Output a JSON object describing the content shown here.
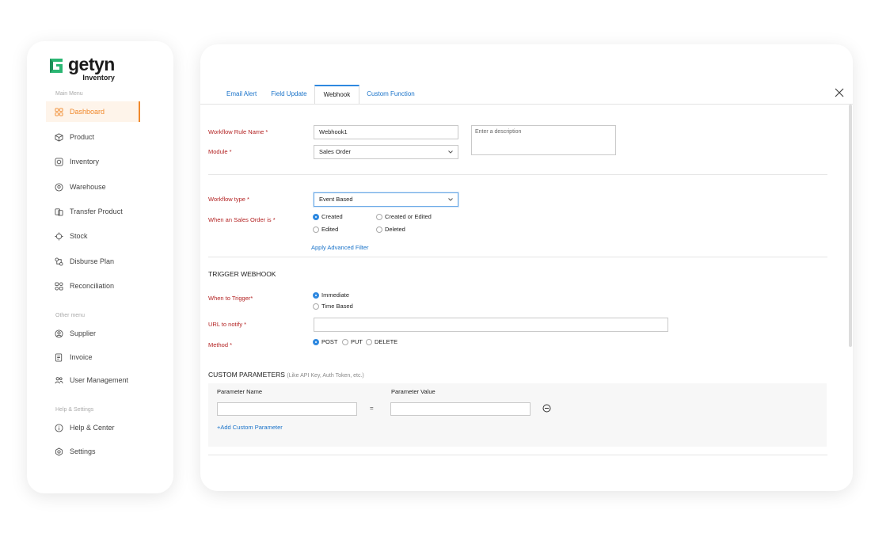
{
  "brand": {
    "name": "getyn",
    "sub": "Inventory",
    "accent": "#f0892c",
    "logo_color": "#2bb673"
  },
  "sidebar": {
    "main_menu_label": "Main Menu",
    "main_items": [
      {
        "label": "Dashboard",
        "icon": "grid-icon",
        "active": true
      },
      {
        "label": "Product",
        "icon": "box-icon"
      },
      {
        "label": "Inventory",
        "icon": "inventory-icon"
      },
      {
        "label": "Warehouse",
        "icon": "location-pin-icon"
      },
      {
        "label": "Transfer Product",
        "icon": "transfer-icon"
      },
      {
        "label": "Stock",
        "icon": "stock-icon"
      },
      {
        "label": "Disburse Plan",
        "icon": "disburse-icon"
      },
      {
        "label": "Reconciliation",
        "icon": "reconciliation-icon"
      }
    ],
    "other_menu_label": "Other menu",
    "other_items": [
      {
        "label": "Supplier",
        "icon": "supplier-icon"
      },
      {
        "label": "Invoice",
        "icon": "invoice-icon"
      },
      {
        "label": "User Management",
        "icon": "users-icon"
      }
    ],
    "help_label": "Help & Settings",
    "help_items": [
      {
        "label": "Help & Center",
        "icon": "info-icon"
      },
      {
        "label": "Settings",
        "icon": "gear-icon"
      }
    ]
  },
  "tabs": [
    "Email Alert",
    "Field Update",
    "Webhook",
    "Custom Function"
  ],
  "active_tab": "Webhook",
  "form": {
    "rule_name_label": "Workflow Rule Name *",
    "rule_name_value": "Webhook1",
    "description_placeholder": "Enter a description",
    "module_label": "Module *",
    "module_value": "Sales Order",
    "workflow_type_label": "Workflow type *",
    "workflow_type_value": "Event Based",
    "when_label": "When an Sales Order is *",
    "when_options": [
      "Created",
      "Created or Edited",
      "Edited",
      "Deleted"
    ],
    "when_selected": "Created",
    "advanced_filter": "Apply Advanced Filter"
  },
  "webhook": {
    "heading": "TRIGGER WEBHOOK",
    "when_label": "When to Trigger*",
    "trigger_options": [
      "Immediate",
      "Time Based"
    ],
    "trigger_selected": "Immediate",
    "url_label": "URL to notify *",
    "url_value": "",
    "method_label": "Method *",
    "methods": [
      "POST",
      "PUT",
      "DELETE"
    ],
    "method_selected": "POST"
  },
  "custom_params": {
    "heading": "CUSTOM PARAMETERS",
    "heading_note": "(Like API Key, Auth Token, etc.)",
    "name_header": "Parameter Name",
    "value_header": "Parameter Value",
    "equals": "=",
    "add_link": "+Add Custom Parameter"
  }
}
